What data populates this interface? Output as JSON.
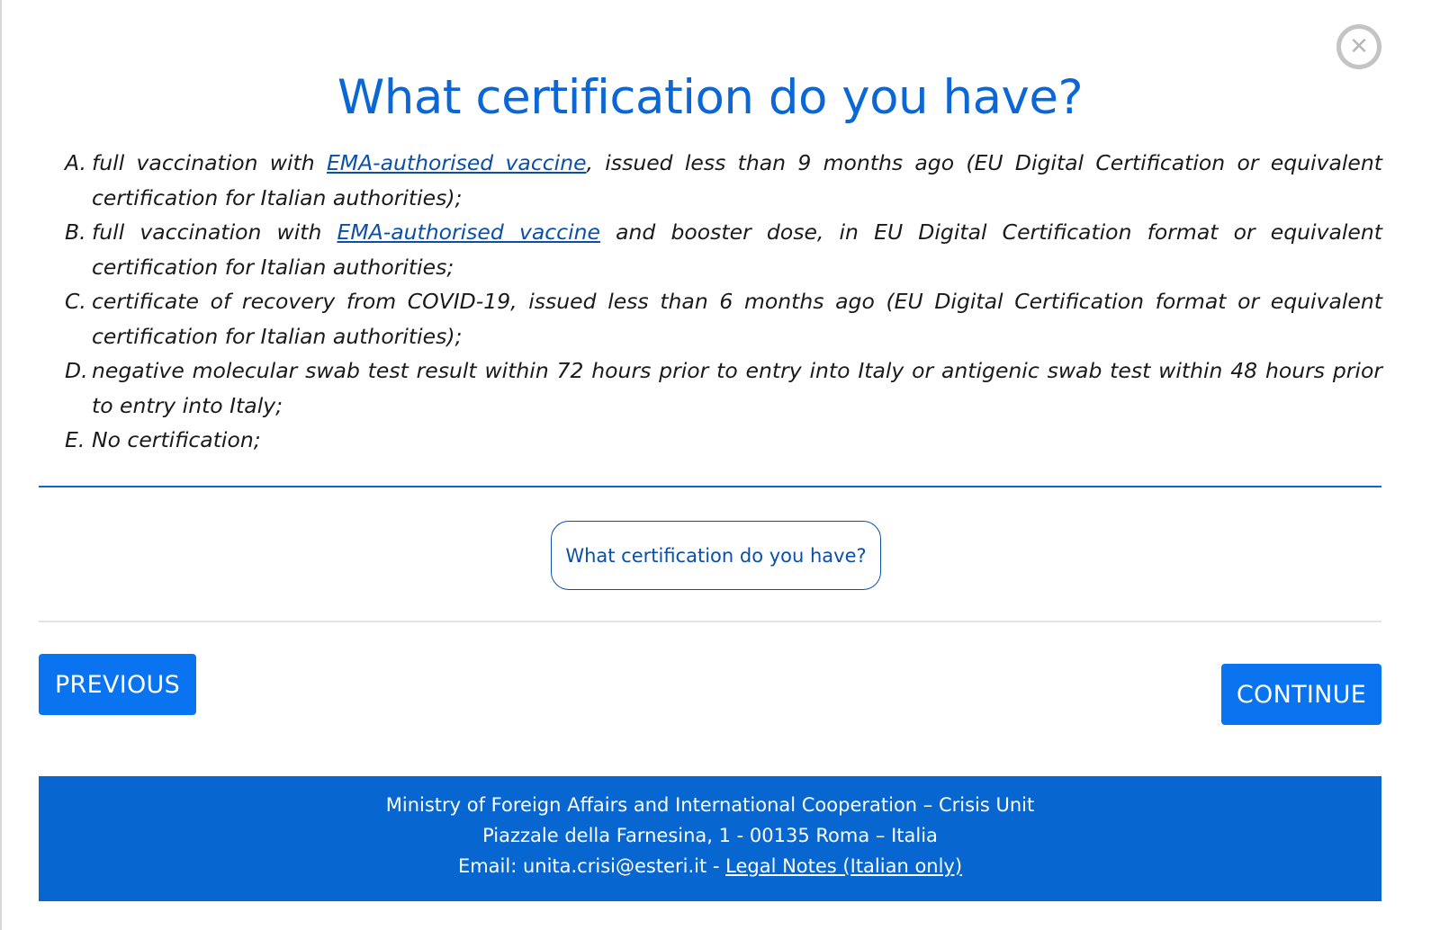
{
  "dialog": {
    "close_icon": "close-circle-icon",
    "close_glyph": "✕",
    "title": "What certification do you have?"
  },
  "options": [
    {
      "letter": "A.",
      "before_link": "full vaccination with ",
      "link": "EMA-authorised vaccine",
      "after_link": ", issued less than 9 months ago (EU Digital Certification or equivalent certification for Italian authorities);"
    },
    {
      "letter": "B.",
      "before_link": "full vaccination with ",
      "link": "EMA-authorised vaccine",
      "after_link": " and booster dose, in EU Digital Certification format or equivalent certification for Italian authorities;"
    },
    {
      "letter": "C.",
      "text": "certificate of recovery from COVID-19, issued less than 6 months ago (EU Digital Certification format or equivalent certification for Italian authorities);"
    },
    {
      "letter": "D.",
      "text": "negative molecular swab test result within 72 hours prior to entry into Italy or antigenic swab test within 48 hours prior to entry into Italy;"
    },
    {
      "letter": "E.",
      "text": "No certification;"
    }
  ],
  "question_chip": "What certification do you have?",
  "buttons": {
    "previous": "PREVIOUS",
    "continue": "CONTINUE"
  },
  "footer": {
    "line1": "Ministry of Foreign Affairs and International Cooperation – Crisis Unit",
    "line2": "Piazzale della Farnesina, 1 - 00135 Roma – Italia",
    "email_prefix": "Email: unita.crisi@esteri.it - ",
    "legal_link": "Legal Notes (Italian only)"
  },
  "colors": {
    "title_blue": "#0b66d6",
    "button_blue": "#0a73f0",
    "footer_blue": "#0766cf",
    "link_blue": "#0b4fa8"
  }
}
